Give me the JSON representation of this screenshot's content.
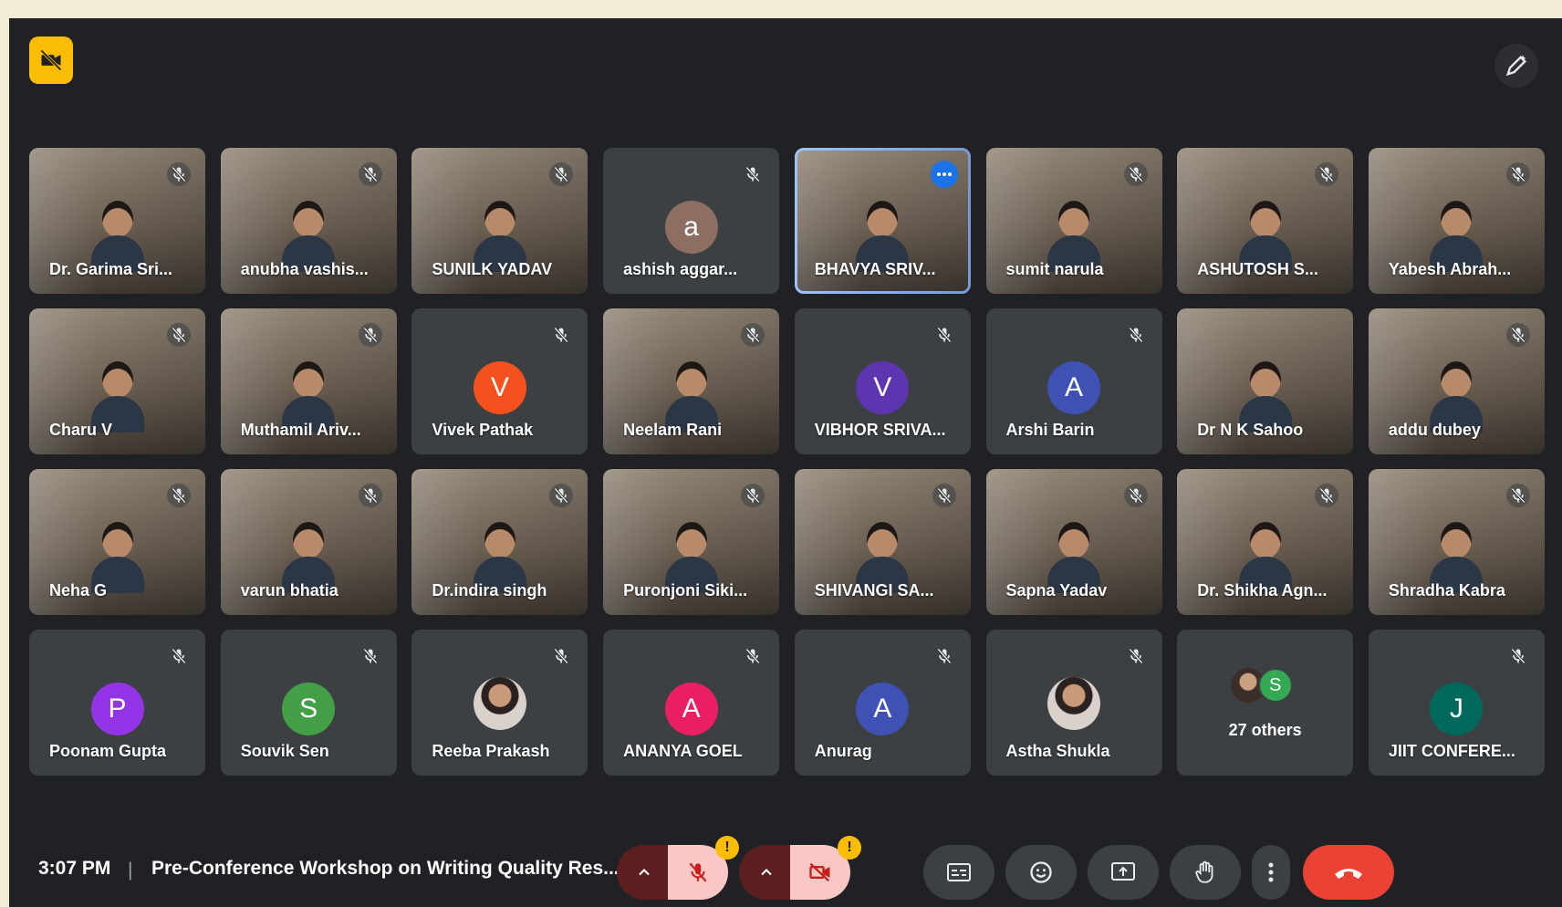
{
  "meeting": {
    "time": "3:07 PM",
    "separator": "|",
    "title": "Pre-Conference Workshop on Writing Quality Res..."
  },
  "participants": [
    {
      "name": "Dr. Garima Sri...",
      "type": "video",
      "muted": true
    },
    {
      "name": "anubha vashis...",
      "type": "video",
      "muted": true
    },
    {
      "name": "SUNILK YADAV",
      "type": "video",
      "muted": true
    },
    {
      "name": "ashish aggar...",
      "type": "avatar",
      "initial": "a",
      "color": "#8d6e63",
      "muted": true
    },
    {
      "name": "BHAVYA SRIV...",
      "type": "video",
      "muted": false,
      "active": true
    },
    {
      "name": "sumit narula",
      "type": "video",
      "muted": true
    },
    {
      "name": "ASHUTOSH S...",
      "type": "video",
      "muted": true
    },
    {
      "name": "Yabesh Abrah...",
      "type": "video",
      "muted": true
    },
    {
      "name": "Charu V",
      "type": "video",
      "muted": true
    },
    {
      "name": "Muthamil Ariv...",
      "type": "video",
      "muted": true
    },
    {
      "name": "Vivek Pathak",
      "type": "avatar",
      "initial": "V",
      "color": "#f4511e",
      "muted": true
    },
    {
      "name": "Neelam Rani",
      "type": "video",
      "muted": true
    },
    {
      "name": "VIBHOR SRIVA...",
      "type": "avatar",
      "initial": "V",
      "color": "#5e35b1",
      "muted": true
    },
    {
      "name": "Arshi Barin",
      "type": "avatar",
      "initial": "A",
      "color": "#3f51b5",
      "muted": true
    },
    {
      "name": "Dr N K Sahoo",
      "type": "video",
      "muted": false
    },
    {
      "name": "addu dubey",
      "type": "video",
      "muted": true
    },
    {
      "name": "Neha G",
      "type": "video",
      "muted": true
    },
    {
      "name": "varun bhatia",
      "type": "video",
      "muted": true
    },
    {
      "name": "Dr.indira singh",
      "type": "video",
      "muted": true
    },
    {
      "name": "Puronjoni Siki...",
      "type": "video",
      "muted": true
    },
    {
      "name": "SHIVANGI SA...",
      "type": "video",
      "muted": true
    },
    {
      "name": "Sapna Yadav",
      "type": "video",
      "muted": true
    },
    {
      "name": "Dr. Shikha Agn...",
      "type": "video",
      "muted": true
    },
    {
      "name": "Shradha Kabra",
      "type": "video",
      "muted": true
    },
    {
      "name": "Poonam Gupta",
      "type": "avatar",
      "initial": "P",
      "color": "#9334e6",
      "muted": true
    },
    {
      "name": "Souvik Sen",
      "type": "avatar",
      "initial": "S",
      "color": "#43a047",
      "muted": true
    },
    {
      "name": "Reeba Prakash",
      "type": "photo",
      "muted": true
    },
    {
      "name": "ANANYA GOEL",
      "type": "avatar",
      "initial": "A",
      "color": "#e91e63",
      "muted": true
    },
    {
      "name": "Anurag",
      "type": "avatar",
      "initial": "A",
      "color": "#3f51b5",
      "muted": true
    },
    {
      "name": "Astha Shukla",
      "type": "photo",
      "muted": true
    },
    {
      "name": "27 others",
      "type": "others",
      "initial": "S",
      "muted": false
    },
    {
      "name": "JIIT CONFERE...",
      "type": "avatar",
      "initial": "J",
      "color": "#00695c",
      "muted": true
    }
  ],
  "controls": {
    "mic_warning": "!",
    "cam_warning": "!"
  },
  "icons": {
    "recording": "no-camera-icon",
    "pen": "edit-pen-icon"
  }
}
